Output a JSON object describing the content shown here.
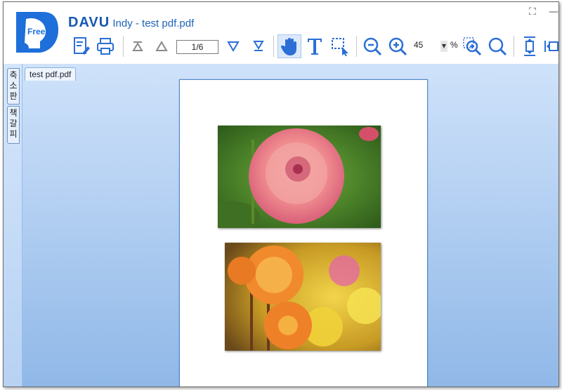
{
  "app": {
    "brand": "DAVU",
    "subtitle": "Indy - test pdf.pdf",
    "logo_text": "Free"
  },
  "window_controls": [
    "restore-icon",
    "minimize-icon"
  ],
  "toolbar": {
    "icons": [
      "edit-document-icon",
      "print-icon",
      "first-page-icon",
      "previous-page-icon",
      "next-page-icon",
      "last-page-icon",
      "hand-tool-icon",
      "text-select-icon",
      "area-select-icon",
      "zoom-out-icon",
      "zoom-in-icon",
      "zoom-area-icon",
      "search-icon",
      "fit-height-icon",
      "fit-width-icon"
    ],
    "page_value": "1/6",
    "zoom_value": "45",
    "zoom_unit": "%"
  },
  "side_tabs": [
    {
      "label": "축소판"
    },
    {
      "label": "책갈피"
    }
  ],
  "document_tab": {
    "label": "test pdf.pdf"
  },
  "page": {
    "images": [
      "pink-dahlia-photo",
      "orange-dahlia-photo"
    ]
  },
  "colors": {
    "accent": "#1f63b8",
    "toolbar_icon": "#2b6fd6",
    "workspace_top": "#cfe2fa",
    "workspace_bottom": "#90b8e8"
  }
}
